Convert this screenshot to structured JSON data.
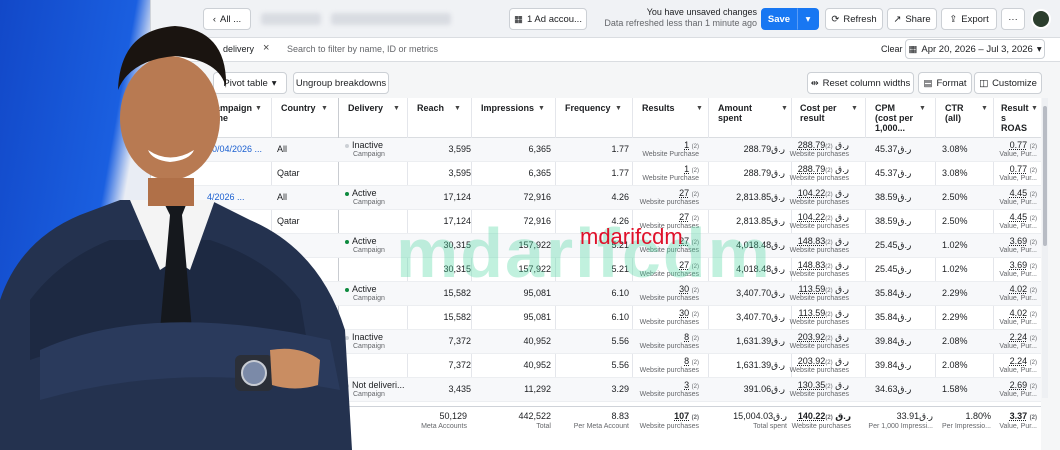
{
  "colors": {
    "accent": "#1877f2",
    "active": "#0e8a3e",
    "inactive": "#8a8d91",
    "watermark": "#4cd6a0",
    "watermark_red": "#e0102a"
  },
  "topbar": {
    "all_label": "All ...",
    "ad_accounts": "1 Ad accou...",
    "unsaved": "You have unsaved changes",
    "refreshed": "Data refreshed less than 1 minute ago",
    "save": "Save",
    "refresh": "Refresh",
    "share": "Share",
    "export": "Export",
    "more": "···"
  },
  "filter": {
    "chip": "delivery",
    "placeholder": "Search to filter by name, ID or metrics",
    "clear": "Clear",
    "date_range": "Apr 20, 2026 – Jul 3, 2026"
  },
  "toolbar": {
    "pivot": "Pivot table",
    "ungroup": "Ungroup breakdowns",
    "reset_widths": "Reset column widths",
    "format": "Format",
    "customize": "Customize"
  },
  "headers": {
    "campaign": [
      "ampaign",
      "me"
    ],
    "country": "Country",
    "delivery": "Delivery",
    "reach": "Reach",
    "impressions": "Impressions",
    "frequency": "Frequency",
    "results": "Results",
    "amount": [
      "Amount",
      "spent"
    ],
    "cpr": [
      "Cost per",
      "result"
    ],
    "cpm": [
      "CPM",
      "(cost per",
      "1,000..."
    ],
    "ctr": [
      "CTR",
      "(all)"
    ],
    "roas": [
      "Result",
      "s",
      "ROAS"
    ]
  },
  "rows": [
    {
      "campaign": "20/04/2026 ...",
      "country": "All",
      "delivery": "Inactive",
      "delivery_sub": "Campaign",
      "status": "inactive",
      "reach": "3,595",
      "impressions": "6,365",
      "frequency": "1.77",
      "results": "1",
      "results_sub": "Website Purchase",
      "amount": "288.79",
      "cpr": "288.79",
      "cpr_sub": "Website purchases",
      "cpm": "45.37",
      "ctr": "3.08%",
      "roas": "0.77",
      "roas_sub": "Value, Pur..."
    },
    {
      "campaign": "",
      "country": "Qatar",
      "delivery": "",
      "delivery_sub": "",
      "status": "",
      "reach": "3,595",
      "impressions": "6,365",
      "frequency": "1.77",
      "results": "1",
      "results_sub": "Website Purchase",
      "amount": "288.79",
      "cpr": "288.79",
      "cpr_sub": "Website purchases",
      "cpm": "45.37",
      "ctr": "3.08%",
      "roas": "0.77",
      "roas_sub": "Value, Pur..."
    },
    {
      "campaign": "4/2026 ...",
      "country": "All",
      "delivery": "Active",
      "delivery_sub": "Campaign",
      "status": "active",
      "reach": "17,124",
      "impressions": "72,916",
      "frequency": "4.26",
      "results": "27",
      "results_sub": "Website purchases",
      "amount": "2,813.85",
      "cpr": "104.22",
      "cpr_sub": "Website purchases",
      "cpm": "38.59",
      "ctr": "2.50%",
      "roas": "4.45",
      "roas_sub": "Value, Pur..."
    },
    {
      "campaign": "",
      "country": "Qatar",
      "delivery": "",
      "delivery_sub": "",
      "status": "",
      "reach": "17,124",
      "impressions": "72,916",
      "frequency": "4.26",
      "results": "27",
      "results_sub": "Website purchases",
      "amount": "2,813.85",
      "cpr": "104.22",
      "cpr_sub": "Website purchases",
      "cpm": "38.59",
      "ctr": "2.50%",
      "roas": "4.45",
      "roas_sub": "Value, Pur..."
    },
    {
      "campaign": "",
      "country": "",
      "delivery": "Active",
      "delivery_sub": "Campaign",
      "status": "active",
      "reach": "30,315",
      "impressions": "157,922",
      "frequency": "5.21",
      "results": "27",
      "results_sub": "Website purchases",
      "amount": "4,018.48",
      "cpr": "148.83",
      "cpr_sub": "Website purchases",
      "cpm": "25.45",
      "ctr": "1.02%",
      "roas": "3.69",
      "roas_sub": "Value, Pur..."
    },
    {
      "campaign": "",
      "country": "",
      "delivery": "",
      "delivery_sub": "",
      "status": "",
      "reach": "30,315",
      "impressions": "157,922",
      "frequency": "5.21",
      "results": "27",
      "results_sub": "Website purchases",
      "amount": "4,018.48",
      "cpr": "148.83",
      "cpr_sub": "Website purchases",
      "cpm": "25.45",
      "ctr": "1.02%",
      "roas": "3.69",
      "roas_sub": "Value, Pur..."
    },
    {
      "campaign": "",
      "country": "",
      "delivery": "Active",
      "delivery_sub": "Campaign",
      "status": "active",
      "reach": "15,582",
      "impressions": "95,081",
      "frequency": "6.10",
      "results": "30",
      "results_sub": "Website purchases",
      "amount": "3,407.70",
      "cpr": "113.59",
      "cpr_sub": "Website purchases",
      "cpm": "35.84",
      "ctr": "2.29%",
      "roas": "4.02",
      "roas_sub": "Value, Pur..."
    },
    {
      "campaign": "",
      "country": "",
      "delivery": "",
      "delivery_sub": "",
      "status": "",
      "reach": "15,582",
      "impressions": "95,081",
      "frequency": "6.10",
      "results": "30",
      "results_sub": "Website purchases",
      "amount": "3,407.70",
      "cpr": "113.59",
      "cpr_sub": "Website purchases",
      "cpm": "35.84",
      "ctr": "2.29%",
      "roas": "4.02",
      "roas_sub": "Value, Pur..."
    },
    {
      "campaign": "",
      "country": "",
      "delivery": "Inactive",
      "delivery_sub": "Campaign",
      "status": "inactive",
      "reach": "7,372",
      "impressions": "40,952",
      "frequency": "5.56",
      "results": "8",
      "results_sub": "Website purchases",
      "amount": "1,631.39",
      "cpr": "203.92",
      "cpr_sub": "Website purchases",
      "cpm": "39.84",
      "ctr": "2.08%",
      "roas": "2.24",
      "roas_sub": "Value, Pur..."
    },
    {
      "campaign": "",
      "country": "",
      "delivery": "",
      "delivery_sub": "",
      "status": "",
      "reach": "7,372",
      "impressions": "40,952",
      "frequency": "5.56",
      "results": "8",
      "results_sub": "Website purchases",
      "amount": "1,631.39",
      "cpr": "203.92",
      "cpr_sub": "Website purchases",
      "cpm": "39.84",
      "ctr": "2.08%",
      "roas": "2.24",
      "roas_sub": "Value, Pur..."
    },
    {
      "campaign": "",
      "country": "",
      "delivery": "Not deliveri...",
      "delivery_sub": "Campaign",
      "status": "inactive",
      "reach": "3,435",
      "impressions": "11,292",
      "frequency": "3.29",
      "results": "3",
      "results_sub": "Website purchases",
      "amount": "391.06",
      "cpr": "130.35",
      "cpr_sub": "Website purchases",
      "cpm": "34.63",
      "ctr": "1.58%",
      "roas": "2.69",
      "roas_sub": "Value, Pur..."
    }
  ],
  "currency": "ر.ق",
  "sup": "(2)",
  "totals": {
    "reach": "50,129",
    "reach_sub": "Meta Accounts",
    "impressions": "442,522",
    "impressions_sub": "Total",
    "frequency": "8.83",
    "frequency_sub": "Per Meta Account",
    "results": "107",
    "results_sub": "Website purchases",
    "amount": "15,004.03",
    "amount_sub": "Total spent",
    "cpr": "140.22",
    "cpr_sub": "Website purchases",
    "cpm": "33.91",
    "cpm_sub": "Per 1,000 Impressi...",
    "ctr": "1.80%",
    "ctr_sub": "Per Impressio...",
    "roas": "3.37",
    "roas_sub": "Value, Pur..."
  },
  "watermark": {
    "logo": "mdarifcdm",
    "text": "mdarifcdm"
  }
}
